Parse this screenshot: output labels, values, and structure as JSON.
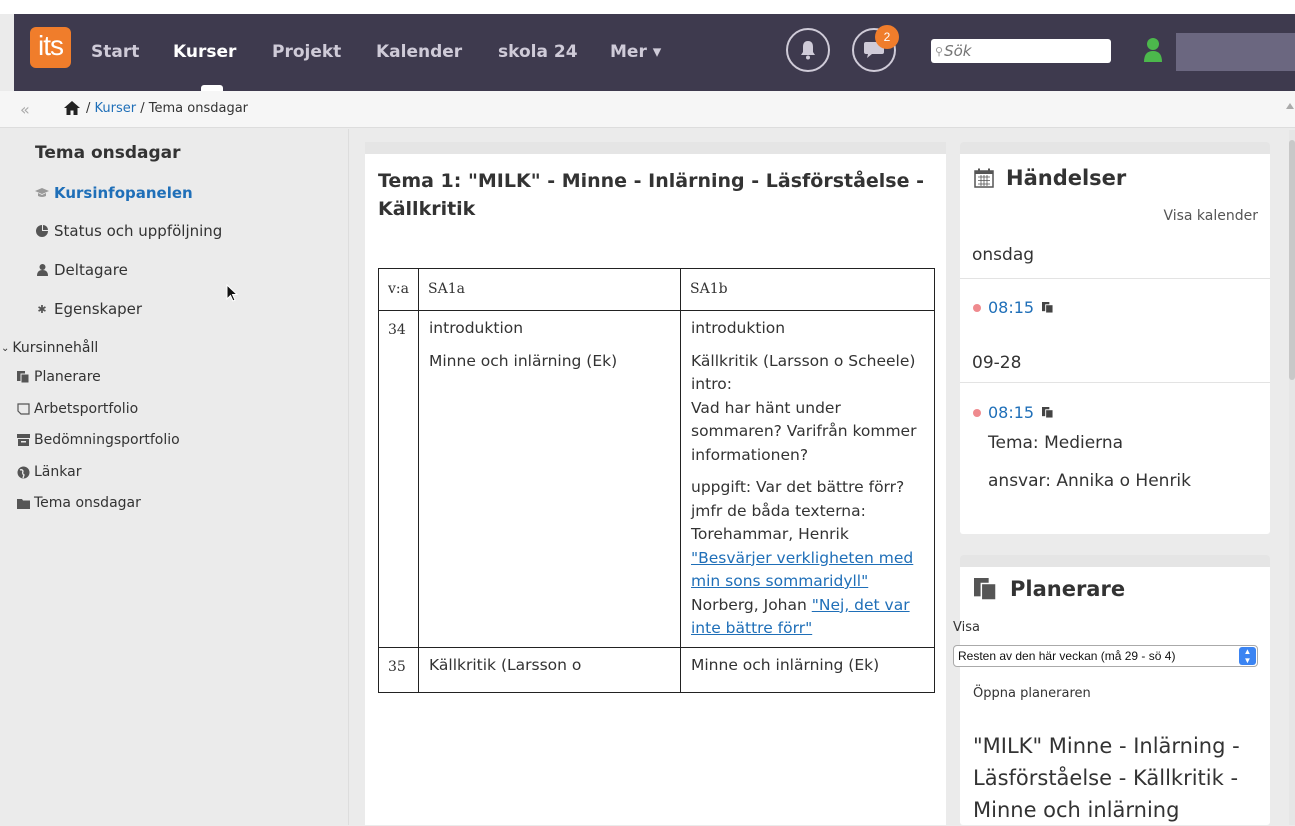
{
  "nav": {
    "logo": "its",
    "links": [
      "Start",
      "Kurser",
      "Projekt",
      "Kalender",
      "skola 24",
      "Mer ▾"
    ],
    "active": "Kurser",
    "messages_badge": "2",
    "search_placeholder": "Sök"
  },
  "breadcrumb": {
    "courses": "Kurser",
    "separator": "/",
    "current": "Tema onsdagar"
  },
  "sidebar": {
    "title": "Tema onsdagar",
    "items": [
      {
        "label": "Kursinfopanelen",
        "icon": "mortarboard-icon",
        "active": true
      },
      {
        "label": "Status och uppföljning",
        "icon": "pie-chart-icon"
      },
      {
        "label": "Deltagare",
        "icon": "user-icon"
      },
      {
        "label": "Egenskaper",
        "icon": "gear-icon"
      }
    ],
    "section": "Kursinnehåll",
    "subitems": [
      {
        "label": "Planerare",
        "icon": "planner-icon"
      },
      {
        "label": "Arbetsportfolio",
        "icon": "portfolio-icon"
      },
      {
        "label": "Bedömningsportfolio",
        "icon": "archive-icon"
      },
      {
        "label": "Länkar",
        "icon": "globe-icon"
      },
      {
        "label": "Tema onsdagar",
        "icon": "folder-icon"
      }
    ]
  },
  "main": {
    "title": "Tema 1: \"MILK\" - Minne - Inlärning - Läsförståelse - Källkritik",
    "table": {
      "headers": [
        "v:a",
        "SA1a",
        "SA1b"
      ],
      "row1": {
        "week": "34",
        "a1": "introduktion",
        "a2": "Minne och inlärning (Ek)",
        "b1": "introduktion",
        "b2_l1": "Källkritik (Larsson o Scheele)",
        "b2_l2": "intro:",
        "b2_l3": "Vad har hänt under sommaren? Varifrån kommer informationen?",
        "b3_text": "uppgift: Var det bättre förr? jmfr de båda texterna: Torehammar, Henrik ",
        "b3_link1": "\"Besvärjer verkligheten med min sons sommaridyll\"",
        "b3_text2": "Norberg, Johan ",
        "b3_link2": "\"Nej, det var inte bättre förr\""
      },
      "row2": {
        "week": "35",
        "a1": "Källkritik (Larsson o",
        "b1": "Minne och inlärning (Ek)"
      }
    }
  },
  "events": {
    "title": "Händelser",
    "show_calendar": "Visa kalender",
    "day1": "onsdag",
    "time1": "08:15",
    "day2": "09-28",
    "time2": "08:15",
    "line1": "Tema: Medierna",
    "line2": "ansvar: Annika o Henrik",
    "dot_color": "#ef8a8e"
  },
  "planner": {
    "title": "Planerare",
    "show_label": "Visa",
    "select_value": "Resten av den här veckan (må 29 - sö 4)",
    "open_link": "Öppna planeraren",
    "item": "\"MILK\" Minne - Inlärning - Läsförståelse - Källkritik - Minne och inlärning"
  },
  "colors": {
    "nav_bg": "#3e3a4e",
    "logo": "#f07d2b",
    "link": "#1f6fb8",
    "user_icon": "#4cb84c"
  }
}
